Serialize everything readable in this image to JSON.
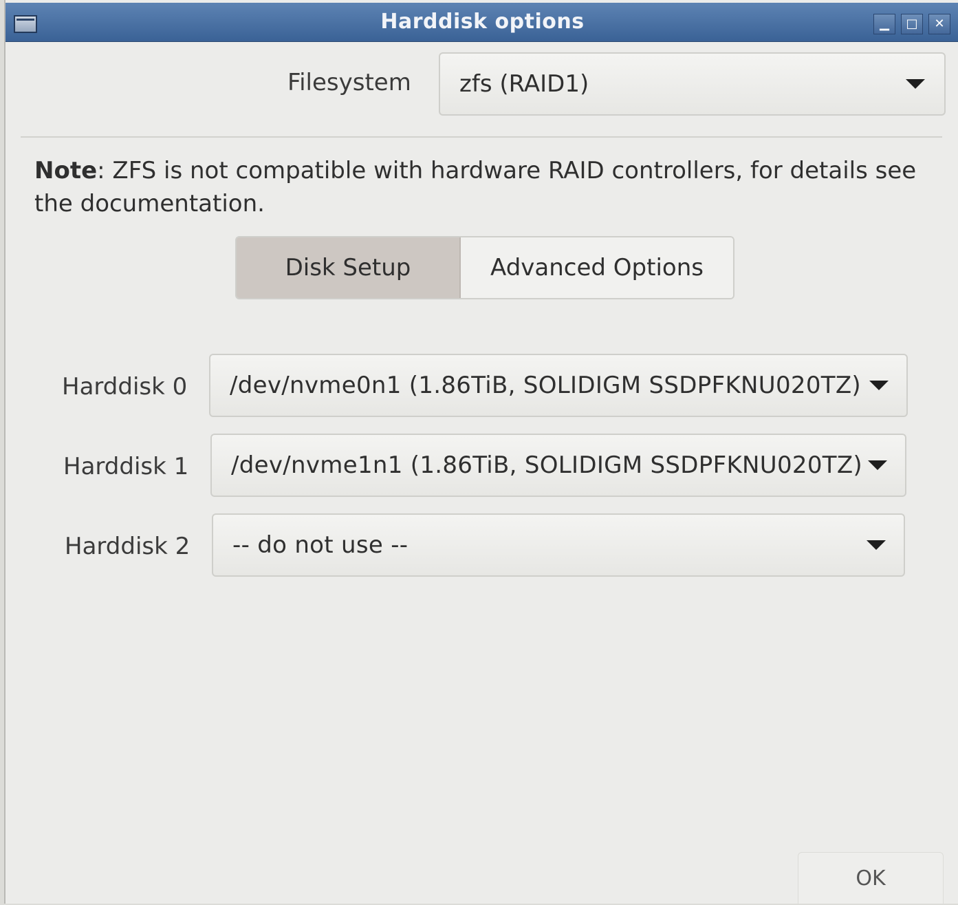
{
  "window": {
    "title": "Harddisk options",
    "controls": {
      "minimize": "▁",
      "maximize": "□",
      "close": "✕"
    }
  },
  "filesystem": {
    "label": "Filesystem",
    "value": "zfs (RAID1)"
  },
  "note": {
    "prefix": "Note",
    "text": ": ZFS is not compatible with hardware RAID controllers, for details see the documentation."
  },
  "tabs": [
    {
      "label": "Disk Setup",
      "active": true
    },
    {
      "label": "Advanced Options",
      "active": false
    }
  ],
  "harddisks": [
    {
      "label": "Harddisk 0",
      "value": "/dev/nvme0n1 (1.86TiB, SOLIDIGM SSDPFKNU020TZ)"
    },
    {
      "label": "Harddisk 1",
      "value": "/dev/nvme1n1 (1.86TiB, SOLIDIGM SSDPFKNU020TZ)"
    },
    {
      "label": "Harddisk 2",
      "value": "-- do not use --"
    }
  ],
  "footer": {
    "ok_label": "OK"
  },
  "icons": {
    "window_menu": "window-menu-icon",
    "dropdown": "chevron-down-icon"
  }
}
